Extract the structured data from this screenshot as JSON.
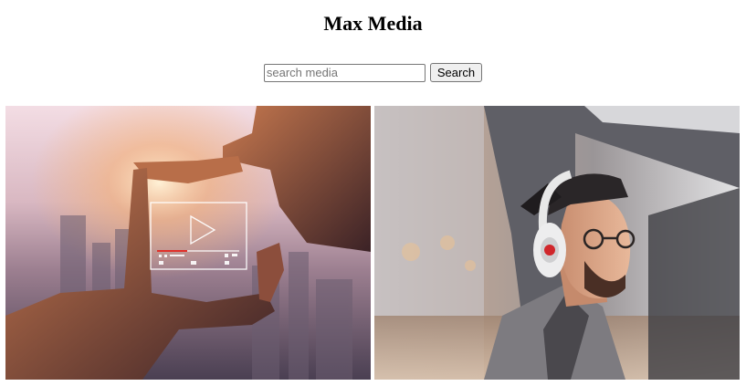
{
  "header": {
    "title": "Max Media"
  },
  "search": {
    "placeholder": "search media",
    "value": "",
    "button_label": "Search"
  },
  "gallery": {
    "items": [
      {
        "subject": "hands framing video player over city sunset"
      },
      {
        "subject": "man wearing headphones and backwards cap"
      }
    ]
  }
}
